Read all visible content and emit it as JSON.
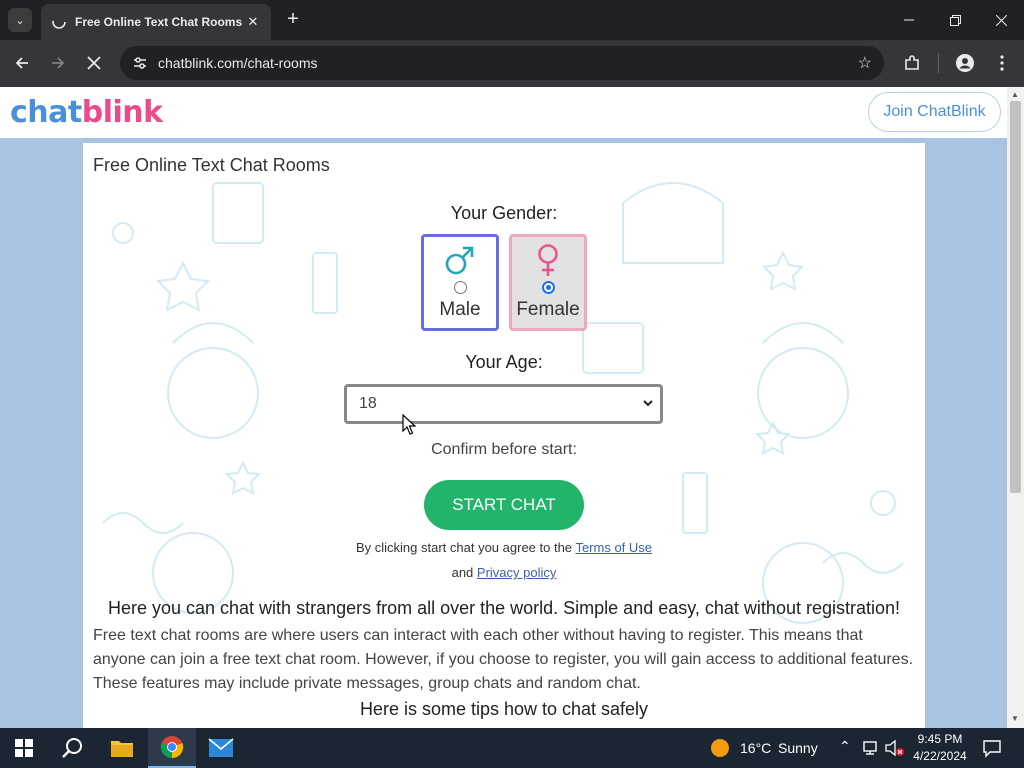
{
  "browser": {
    "tab_title": "Free Online Text Chat Rooms",
    "url": "chatblink.com/chat-rooms"
  },
  "site": {
    "logo_part1": "chat",
    "logo_part2": "blink",
    "join_button": "Join ChatBlink"
  },
  "card": {
    "title": "Free Online Text Chat Rooms",
    "gender_label": "Your Gender:",
    "male_label": "Male",
    "female_label": "Female",
    "selected_gender": "Female",
    "age_label": "Your Age:",
    "age_value": "18",
    "confirm_label": "Confirm before start:",
    "start_button": "START CHAT",
    "terms_prefix": "By clicking start chat you agree to the",
    "terms_link": "Terms of Use",
    "and_text": "and",
    "privacy_link": "Privacy policy",
    "headline": "Here you can chat with strangers from all over the world. Simple and easy, chat without registration!",
    "paragraph": "Free text chat rooms are where users can interact with each other without having to register. This means that anyone can join a free text chat room. However, if you choose to register, you will gain access to additional features. These features may include private messages, group chats and random chat.",
    "tips_heading": "Here is some tips how to chat safely"
  },
  "taskbar": {
    "weather_temp": "16°C",
    "weather_desc": "Sunny",
    "time": "9:45 PM",
    "date": "4/22/2024"
  },
  "colors": {
    "accent_blue": "#4a90d9",
    "accent_pink": "#ec4b8b",
    "start_green": "#21b46a",
    "page_bg": "#a9c4e3"
  }
}
